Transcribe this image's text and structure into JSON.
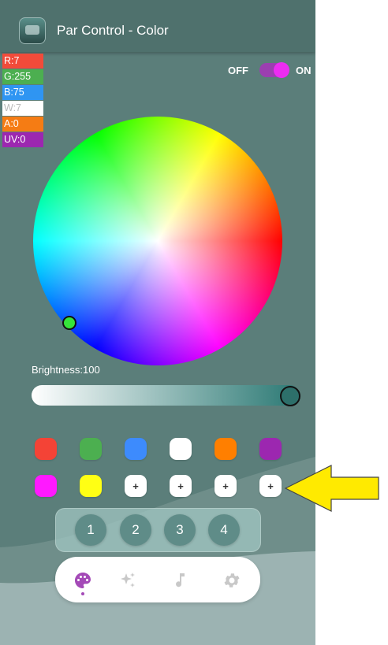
{
  "header": {
    "title": "Par Control - Color",
    "app_icon": "app-logo-icon"
  },
  "channels": [
    {
      "label": "R:7",
      "color": "#f24b3a"
    },
    {
      "label": "G:255",
      "color": "#4caf50"
    },
    {
      "label": "B:75",
      "color": "#2f95f2"
    },
    {
      "label": "W:7",
      "color": "#ffffff",
      "text_color": "#bbbbbb"
    },
    {
      "label": "A:0",
      "color": "#f57c14"
    },
    {
      "label": "UV:0",
      "color": "#9c27b0"
    }
  ],
  "power": {
    "off_label": "OFF",
    "on_label": "ON",
    "state": "on",
    "track_color": "#9b3fb0",
    "knob_color": "#ec2cf2"
  },
  "color_wheel": {
    "selected_color": "#36e43a"
  },
  "brightness": {
    "label": "Brightness:100",
    "value": 100
  },
  "presets": {
    "row1": [
      "#f44336",
      "#4caf50",
      "#3d8bfd",
      "#ffffff",
      "#ff7f00",
      "#9c27b0"
    ],
    "row2": [
      "#ff19ff",
      "#ffff14",
      "+",
      "+",
      "+",
      "+"
    ]
  },
  "scenes": [
    "1",
    "2",
    "3",
    "4"
  ],
  "nav": {
    "items": [
      {
        "icon": "palette-icon",
        "active": true
      },
      {
        "icon": "sparkles-icon",
        "active": false
      },
      {
        "icon": "music-note-icon",
        "active": false
      },
      {
        "icon": "gear-icon",
        "active": false
      }
    ],
    "active_color": "#a44ab7",
    "inactive_color": "#c8c8c8"
  },
  "annotation": {
    "icon": "yellow-arrow-icon",
    "color": "#ffea00"
  }
}
